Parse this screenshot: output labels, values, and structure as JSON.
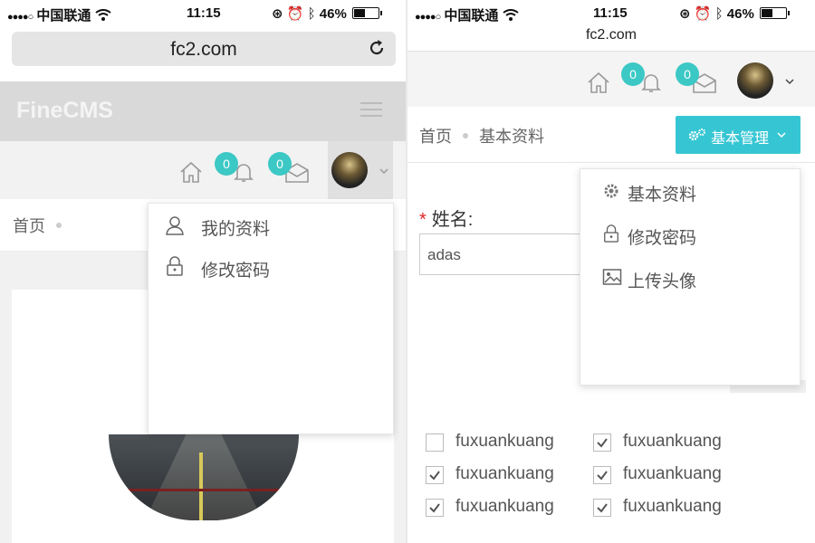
{
  "status_bar": {
    "signal": "●●●●○",
    "carrier": "中国联通",
    "time": "11:15",
    "battery": "46%"
  },
  "left": {
    "url": "fc2.com",
    "brand": "FineCMS",
    "notification_count": "0",
    "message_count": "0",
    "breadcrumb_home": "首页",
    "user_menu": [
      {
        "label": "我的资料",
        "icon": "user-icon"
      },
      {
        "label": "修改密码",
        "icon": "lock-icon"
      }
    ]
  },
  "right": {
    "url": "fc2.com",
    "notification_count": "0",
    "message_count": "0",
    "breadcrumb": [
      "首页",
      "基本资料"
    ],
    "manage_button": "基本管理",
    "manage_menu": [
      {
        "label": "基本资料",
        "icon": "gear-icon"
      },
      {
        "label": "修改密码",
        "icon": "lock-icon"
      },
      {
        "label": "上传头像",
        "icon": "image-icon"
      }
    ],
    "form": {
      "name_required_mark": "*",
      "name_label": "姓名:",
      "name_value": "adas"
    },
    "checkboxes": [
      {
        "label": "fuxuankuang",
        "checked": false
      },
      {
        "label": "fuxuankuang",
        "checked": true
      },
      {
        "label": "fuxuankuang",
        "checked": true
      },
      {
        "label": "fuxuankuang",
        "checked": true
      },
      {
        "label": "fuxuankuang",
        "checked": true
      },
      {
        "label": "fuxuankuang",
        "checked": true
      }
    ]
  },
  "colors": {
    "accent": "#36c6d3",
    "badge": "#3cc8c5",
    "brand_bar": "#d9d9d9",
    "required": "#e02222"
  }
}
